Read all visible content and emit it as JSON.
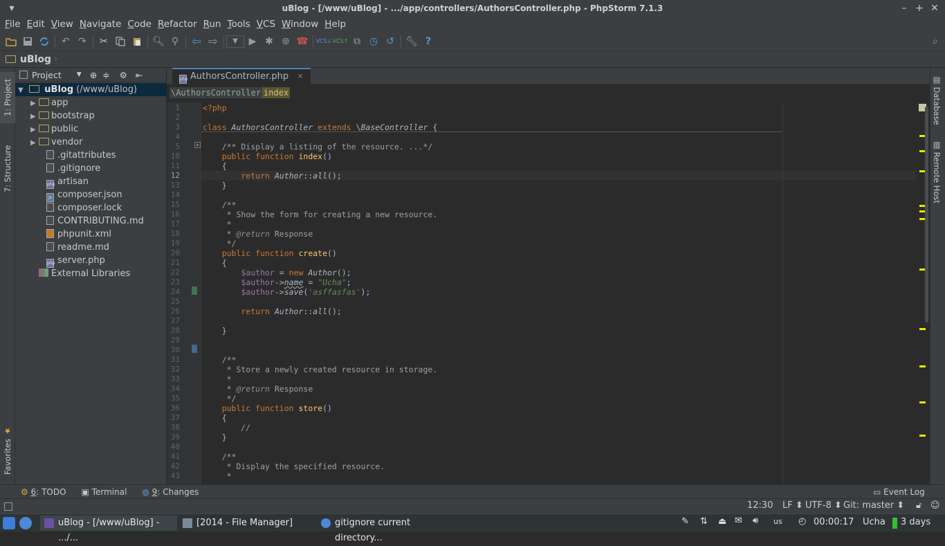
{
  "window": {
    "title": "uBlog - [/www/uBlog] - .../app/controllers/AuthorsController.php - PhpStorm 7.1.3"
  },
  "menu": [
    {
      "mn": "F",
      "rest": "ile"
    },
    {
      "mn": "E",
      "rest": "dit"
    },
    {
      "mn": "V",
      "rest": "iew"
    },
    {
      "mn": "N",
      "rest": "avigate"
    },
    {
      "mn": "C",
      "rest": "ode"
    },
    {
      "mn": "R",
      "rest": "efactor"
    },
    {
      "mn": "R",
      "rest": "un"
    },
    {
      "mn": "T",
      "rest": "ools"
    },
    {
      "mn": "V",
      "rest": "CS"
    },
    {
      "mn": "W",
      "rest": "indow"
    },
    {
      "mn": "H",
      "rest": "elp"
    }
  ],
  "nav": {
    "project": "uBlog"
  },
  "left_tabs": {
    "project": "1: Project",
    "structure": "7: Structure",
    "favorites": "Favorites"
  },
  "right_tabs": {
    "database": "Database",
    "remote": "Remote Host"
  },
  "project_panel": {
    "title": "Project",
    "root": "uBlog",
    "root_path": "(/www/uBlog)",
    "items": [
      {
        "label": "app",
        "type": "folder"
      },
      {
        "label": "bootstrap",
        "type": "folder"
      },
      {
        "label": "public",
        "type": "folder"
      },
      {
        "label": "vendor",
        "type": "folder"
      },
      {
        "label": ".gitattributes",
        "type": "file"
      },
      {
        "label": ".gitignore",
        "type": "file"
      },
      {
        "label": "artisan",
        "type": "php"
      },
      {
        "label": "composer.json",
        "type": "json"
      },
      {
        "label": "composer.lock",
        "type": "file"
      },
      {
        "label": "CONTRIBUTING.md",
        "type": "file"
      },
      {
        "label": "phpunit.xml",
        "type": "xml"
      },
      {
        "label": "readme.md",
        "type": "file"
      },
      {
        "label": "server.php",
        "type": "php"
      }
    ],
    "external": "External Libraries"
  },
  "editor": {
    "tab": "AuthorsController.php",
    "breadcrumb": [
      "\\AuthorsController",
      "index"
    ],
    "current_line": 12,
    "line_numbers": [
      "1",
      "2",
      "3",
      "4",
      "5",
      "10",
      "11",
      "12",
      "13",
      "14",
      "15",
      "16",
      "17",
      "18",
      "19",
      "20",
      "21",
      "22",
      "23",
      "24",
      "25",
      "26",
      "27",
      "28",
      "29",
      "30",
      "31",
      "32",
      "33",
      "34",
      "35",
      "36",
      "37",
      "38",
      "39",
      "40",
      "41",
      "42",
      "43"
    ]
  },
  "tool_windows": {
    "todo_num": "6",
    "todo": ": TODO",
    "terminal": "Terminal",
    "changes_num": "9",
    "changes": ": Changes",
    "event_log": "Event Log"
  },
  "status": {
    "position": "12:30",
    "line_sep": "LF",
    "encoding": "UTF-8",
    "vcs": "Git: master"
  },
  "taskbar": {
    "tasks": [
      "uBlog - [/www/uBlog] - .../...",
      "[2014 - File Manager]",
      "gitignore current directory..."
    ],
    "kb_layout": "us",
    "timer": "00:00:17",
    "user": "Ucha",
    "days": "3 days"
  }
}
